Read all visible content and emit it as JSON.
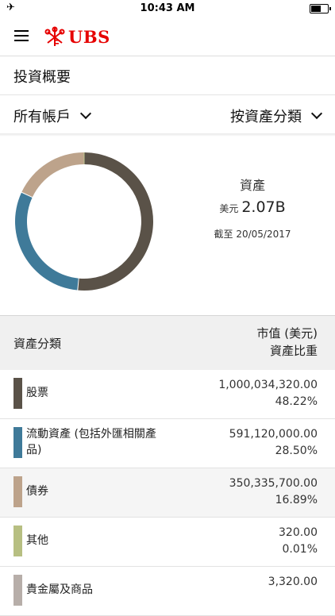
{
  "status": {
    "time": "10:43 AM",
    "airplane_icon": "airplane-icon",
    "battery_level": 0.6
  },
  "nav": {
    "menu_icon": "hamburger-menu-icon",
    "brand": "UBS",
    "brand_color": "#e60000"
  },
  "page": {
    "title": "投資概要"
  },
  "filters": {
    "accounts": "所有帳戶",
    "grouping": "按資產分類"
  },
  "summary": {
    "label": "資產",
    "currency": "美元",
    "total": "2.07B",
    "as_of": "截至 20/05/2017"
  },
  "table": {
    "col_left": "資產分類",
    "col_right_1": "市值 (美元)",
    "col_right_2": "資產比重",
    "rows": [
      {
        "name": "股票",
        "value": "1,000,034,320.00",
        "pct": "48.22%",
        "color": "#5a5248"
      },
      {
        "name": "流動資產 (包括外匯相關產品)",
        "value": "591,120,000.00",
        "pct": "28.50%",
        "color": "#3f7a99"
      },
      {
        "name": "債券",
        "value": "350,335,700.00",
        "pct": "16.89%",
        "color": "#bda38b"
      },
      {
        "name": "其他",
        "value": "320.00",
        "pct": "0.01%",
        "color": "#b7bf82"
      },
      {
        "name": "貴金屬及商品",
        "value": "3,320.00",
        "pct": "",
        "color": "#b7aea9"
      }
    ]
  },
  "chart_data": {
    "type": "pie",
    "categories": [
      "股票",
      "流動資產 (包括外匯相關產品)",
      "債券",
      "其他",
      "貴金屬及商品"
    ],
    "values": [
      48.22,
      28.5,
      16.89,
      0.01,
      0.0002
    ],
    "colors": [
      "#5a5248",
      "#3f7a99",
      "#bda38b",
      "#b7bf82",
      "#b7aea9"
    ],
    "legend": "none"
  }
}
